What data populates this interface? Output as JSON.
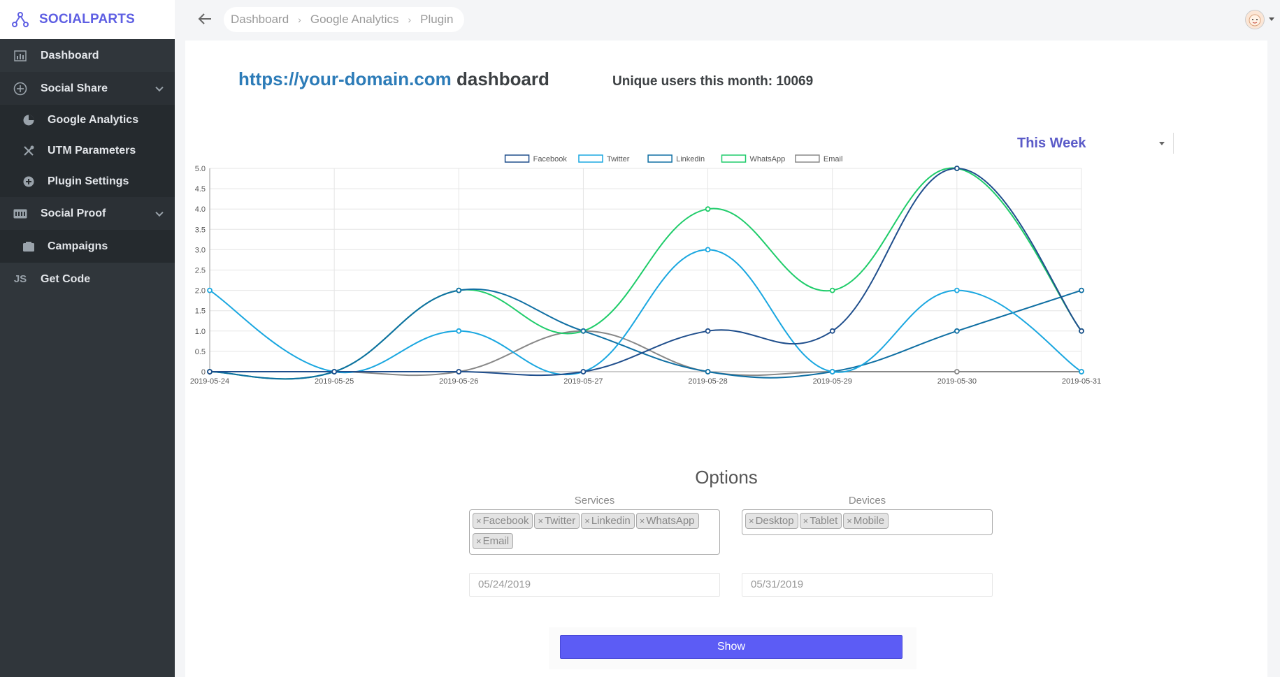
{
  "brand": {
    "name": "SOCIALPARTS"
  },
  "sidebar": {
    "items": [
      {
        "label": "Dashboard",
        "icon": "bar-chart-icon"
      },
      {
        "label": "Social Share",
        "icon": "share-icon"
      },
      {
        "label": "Google Analytics",
        "icon": "pie-chart-icon"
      },
      {
        "label": "UTM Parameters",
        "icon": "tools-icon"
      },
      {
        "label": "Plugin Settings",
        "icon": "plus-circle-icon"
      },
      {
        "label": "Social Proof",
        "icon": "new-badge-icon"
      },
      {
        "label": "Campaigns",
        "icon": "folder-icon"
      },
      {
        "label": "Get Code",
        "icon": "js-icon",
        "icon_text": "JS"
      }
    ]
  },
  "breadcrumb": [
    "Dashboard",
    "Google Analytics",
    "Plugin"
  ],
  "header": {
    "url": "https://your-domain.com",
    "title_suffix": " dashboard",
    "unique_users": "Unique users this month: 10069"
  },
  "period": {
    "selected": "This Week"
  },
  "colors": {
    "accent": "#5e5fe3",
    "facebook": "#1f4e8c",
    "twitter": "#1aa7e0",
    "linkedin": "#0f6fa3",
    "whatsapp": "#1fcc6a",
    "email": "#888888"
  },
  "chart_data": {
    "type": "line",
    "x": [
      "2019-05-24",
      "2019-05-25",
      "2019-05-26",
      "2019-05-27",
      "2019-05-28",
      "2019-05-29",
      "2019-05-30",
      "2019-05-31"
    ],
    "ylim": [
      0,
      5
    ],
    "yticks": [
      "0",
      "0.5",
      "1.0",
      "1.5",
      "2.0",
      "2.5",
      "3.0",
      "3.5",
      "4.0",
      "4.5",
      "5.0"
    ],
    "legend_position": "top",
    "grid": true,
    "series": [
      {
        "name": "Facebook",
        "color": "#1f4e8c",
        "values": [
          0,
          0,
          0,
          0,
          1,
          1,
          5,
          1
        ]
      },
      {
        "name": "Twitter",
        "color": "#1aa7e0",
        "values": [
          2,
          0,
          1,
          0,
          3,
          0,
          2,
          0
        ]
      },
      {
        "name": "Linkedin",
        "color": "#0f6fa3",
        "values": [
          0,
          0,
          2,
          1,
          0,
          0,
          1,
          2
        ]
      },
      {
        "name": "WhatsApp",
        "color": "#1fcc6a",
        "values": [
          0,
          0,
          2,
          1,
          4,
          2,
          5,
          1
        ]
      },
      {
        "name": "Email",
        "color": "#888888",
        "values": [
          0,
          0,
          0,
          1,
          0,
          0,
          0,
          0
        ]
      }
    ]
  },
  "options": {
    "title": "Options",
    "services_label": "Services",
    "services": [
      "Facebook",
      "Twitter",
      "Linkedin",
      "WhatsApp",
      "Email"
    ],
    "devices_label": "Devices",
    "devices": [
      "Desktop",
      "Tablet",
      "Mobile"
    ],
    "start_date": "05/24/2019",
    "end_date": "05/31/2019",
    "show_label": "Show"
  }
}
